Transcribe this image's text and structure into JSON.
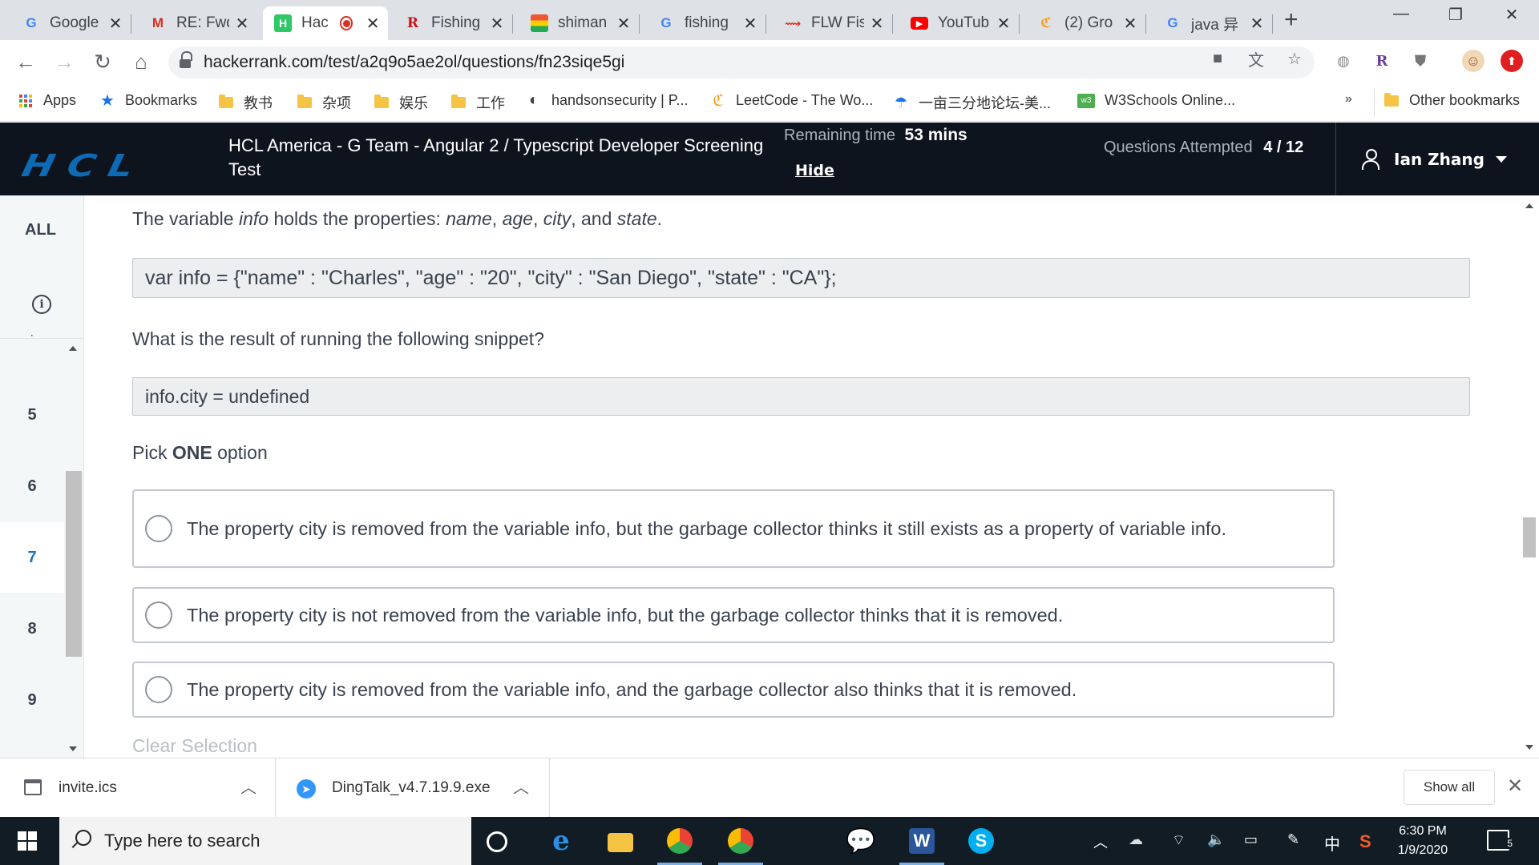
{
  "browser": {
    "tabs": [
      {
        "title": "Google",
        "icon": "google-docs-icon",
        "color": "#4285f4"
      },
      {
        "title": "RE: Fwd",
        "icon": "gmail-icon",
        "color": "#d93025"
      },
      {
        "title": "Hac",
        "icon": "hackerrank-icon",
        "color": "#2ec866",
        "active": true
      },
      {
        "title": "Fishing",
        "icon": "r-icon",
        "color": "#c4161c"
      },
      {
        "title": "shiman",
        "icon": "shimano-icon",
        "color": "#333333"
      },
      {
        "title": "fishing",
        "icon": "google-icon",
        "color": "#4285f4"
      },
      {
        "title": "FLW Fis",
        "icon": "flw-icon",
        "color": "#d93025"
      },
      {
        "title": "YouTub",
        "icon": "youtube-icon",
        "color": "#ff0000"
      },
      {
        "title": "(2) Gro",
        "icon": "leetcode-icon",
        "color": "#f89f1b"
      },
      {
        "title": "java 异",
        "icon": "google-icon",
        "color": "#4285f4"
      }
    ],
    "url": "hackerrank.com/test/a2q9o5ae2ol/questions/fn23siqe5gi",
    "bookmarks": [
      {
        "label": "Apps",
        "icon": "apps-grid-icon"
      },
      {
        "label": "Bookmarks",
        "icon": "star-icon"
      },
      {
        "label": "教书",
        "icon": "folder-icon"
      },
      {
        "label": "杂项",
        "icon": "folder-icon"
      },
      {
        "label": "娱乐",
        "icon": "folder-icon"
      },
      {
        "label": "工作",
        "icon": "folder-icon"
      },
      {
        "label": "handsonsecurity | P...",
        "icon": "globe-icon"
      },
      {
        "label": "LeetCode - The Wo...",
        "icon": "leetcode-icon"
      },
      {
        "label": "一亩三分地论坛-美...",
        "icon": "site-icon"
      },
      {
        "label": "W3Schools Online...",
        "icon": "w3schools-icon"
      }
    ],
    "more_bookmarks": "»",
    "other_bookmarks": "Other bookmarks"
  },
  "header": {
    "logo": "HCL",
    "test_title": "HCL America - G Team - Angular 2 / Typescript Developer Screening Test",
    "remaining_label": "Remaining time",
    "remaining_value": "53 mins",
    "hide_label": "Hide",
    "attempted_label": "Questions Attempted",
    "attempted_value": "4 / 12",
    "user_name": "Ian Zhang"
  },
  "question_nav": {
    "all_label": "ALL",
    "items": [
      "5",
      "6",
      "7",
      "8",
      "9"
    ],
    "current": "7"
  },
  "question": {
    "intro_prefix": "The variable ",
    "intro_var": "info",
    "intro_mid": " holds the properties: ",
    "prop_name": "name",
    "prop_age": "age",
    "prop_city": "city",
    "intro_and": ", and ",
    "prop_state": "state",
    "code1": "var info = {\"name\" : \"Charles\", \"age\" : \"20\", \"city\" : \"San Diego\", \"state\" : \"CA\"};",
    "prompt": "What is the result of running the following snippet?",
    "code2": "info.city = undefined",
    "pick_prefix": "Pick ",
    "pick_bold": "ONE",
    "pick_suffix": " option",
    "options": [
      "The property city is removed from the variable info, but the garbage collector thinks it still exists as a property of variable info.",
      "The property city is not removed from the variable info, but the garbage collector thinks that it is removed.",
      "The property city is removed from the variable info, and the garbage collector also thinks that it is removed."
    ],
    "clear_selection": "Clear Selection"
  },
  "downloads": {
    "items": [
      {
        "name": "invite.ics",
        "icon": "calendar-file-icon"
      },
      {
        "name": "DingTalk_v4.7.19.9.exe",
        "icon": "dingtalk-icon"
      }
    ],
    "show_all": "Show all"
  },
  "taskbar": {
    "search_placeholder": "Type here to search",
    "time": "6:30 PM",
    "date": "1/9/2020",
    "ime": "中",
    "notifications": "5"
  }
}
